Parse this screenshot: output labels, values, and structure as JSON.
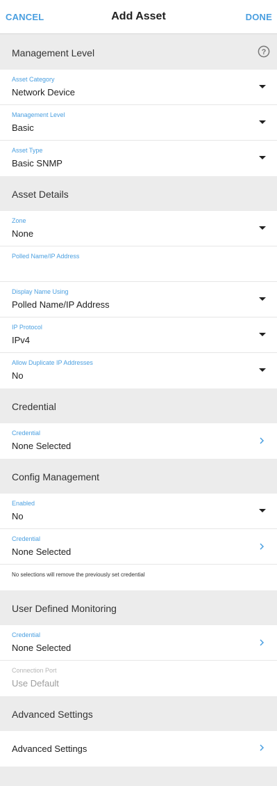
{
  "header": {
    "cancel_label": "CANCEL",
    "title": "Add Asset",
    "done_label": "DONE"
  },
  "sections": {
    "management_level": "Management Level",
    "asset_details": "Asset Details",
    "credential": "Credential",
    "config_management": "Config Management",
    "user_defined_monitoring": "User Defined Monitoring",
    "advanced_settings": "Advanced Settings"
  },
  "fields": {
    "asset_category": {
      "label": "Asset Category",
      "value": "Network Device"
    },
    "management_level": {
      "label": "Management Level",
      "value": "Basic"
    },
    "asset_type": {
      "label": "Asset Type",
      "value": "Basic SNMP"
    },
    "zone": {
      "label": "Zone",
      "value": "None"
    },
    "polled_name": {
      "label": "Polled Name/IP Address",
      "value": ""
    },
    "display_name_using": {
      "label": "Display Name Using",
      "value": "Polled Name/IP Address"
    },
    "ip_protocol": {
      "label": "IP Protocol",
      "value": "IPv4"
    },
    "allow_duplicate_ip": {
      "label": "Allow Duplicate IP Addresses",
      "value": "No"
    },
    "credential": {
      "label": "Credential",
      "value": "None Selected"
    },
    "config_enabled": {
      "label": "Enabled",
      "value": "No"
    },
    "config_credential": {
      "label": "Credential",
      "value": "None Selected"
    },
    "config_note": "No selections will remove the previously set credential",
    "udm_credential": {
      "label": "Credential",
      "value": "None Selected"
    },
    "connection_port": {
      "label": "Connection Port",
      "value": "Use Default"
    },
    "advanced_settings": {
      "label": "Advanced Settings"
    }
  },
  "colors": {
    "accent": "#4a9fe0",
    "section_bg": "#ececec",
    "row_bg": "#ffffff"
  }
}
